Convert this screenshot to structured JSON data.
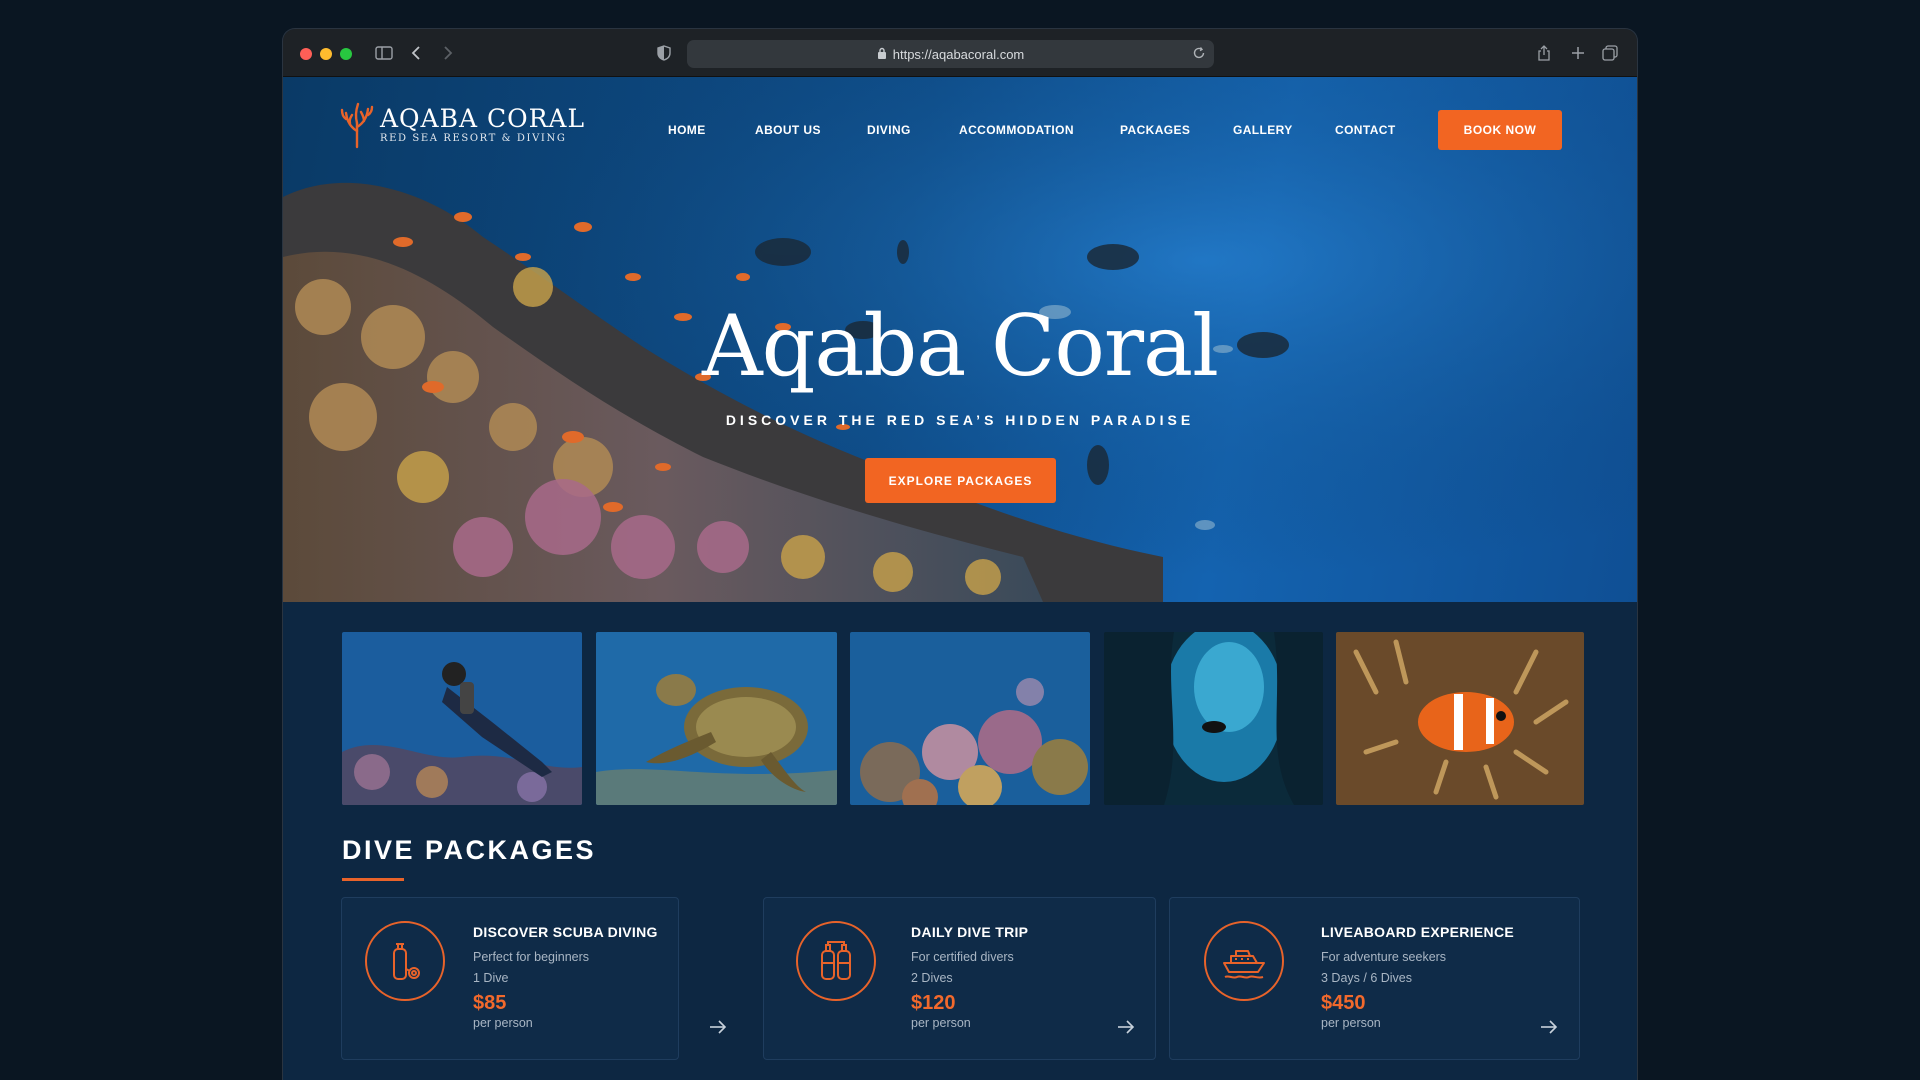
{
  "browser": {
    "url": "https://aqabacoral.com",
    "traffic_lights": [
      "#ff5f57",
      "#febc2e",
      "#28c840"
    ]
  },
  "brand": {
    "name": "AQABA CORAL",
    "tagline": "RED SEA RESORT & DIVING",
    "accent": "#f26522",
    "logo_icon": "coral-icon"
  },
  "nav": {
    "links": [
      "HOME",
      "ABOUT US",
      "DIVING",
      "ACCOMMODATION",
      "PACKAGES",
      "GALLERY",
      "CONTACT"
    ],
    "cta": "BOOK NOW"
  },
  "hero": {
    "title": "Aqaba Coral",
    "subtitle": "DISCOVER THE RED SEA’S HIDDEN PARADISE",
    "cta": "EXPLORE PACKAGES"
  },
  "gallery": [
    "scuba-diver-photo",
    "sea-turtle-photo",
    "coral-reef-photo",
    "underwater-cave-photo",
    "clownfish-photo"
  ],
  "packages_section": {
    "title": "DIVE PACKAGES",
    "cards": [
      {
        "icon": "scuba-tank-icon",
        "title": "DISCOVER SCUBA DIVING",
        "desc": "Perfect for beginners",
        "dives": "1 Dive",
        "price": "$85",
        "per": "per person"
      },
      {
        "icon": "twin-tanks-icon",
        "title": "DAILY DIVE TRIP",
        "desc": "For certified divers",
        "dives": "2 Dives",
        "price": "$120",
        "per": "per person"
      },
      {
        "icon": "boat-icon",
        "title": "LIVEABOARD EXPERIENCE",
        "desc": "For adventure seekers",
        "dives": "3 Days / 6 Dives",
        "price": "$450",
        "per": "per person"
      }
    ]
  }
}
